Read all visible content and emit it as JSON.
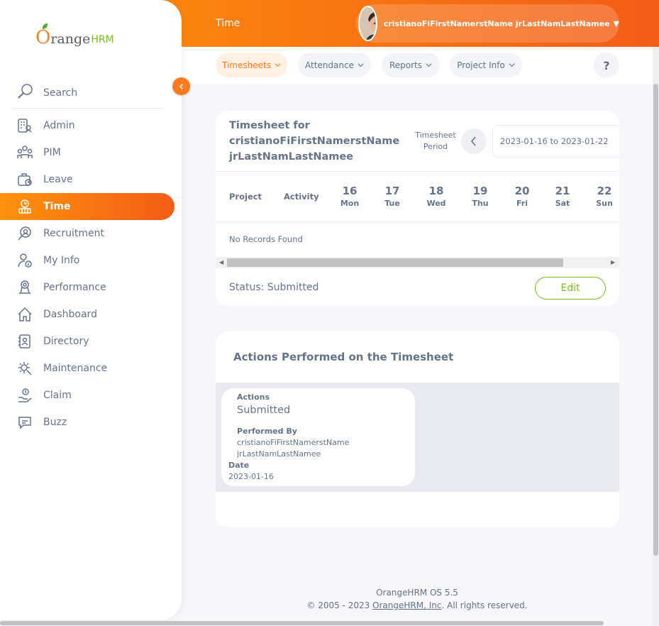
{
  "app": {
    "logo_o": "O",
    "logo_text": "range",
    "logo_suffix": "HRM"
  },
  "topbar": {
    "page_title": "Time",
    "user_name": "cristianoFiFirstNamerstName jrLastNamLastNamee"
  },
  "sidebar": {
    "search_label": "Search",
    "items": [
      {
        "label": "Admin",
        "icon": "admin-icon"
      },
      {
        "label": "PIM",
        "icon": "pim-icon"
      },
      {
        "label": "Leave",
        "icon": "leave-icon"
      },
      {
        "label": "Time",
        "icon": "time-icon",
        "active": true
      },
      {
        "label": "Recruitment",
        "icon": "recruitment-icon"
      },
      {
        "label": "My Info",
        "icon": "my-info-icon"
      },
      {
        "label": "Performance",
        "icon": "performance-icon"
      },
      {
        "label": "Dashboard",
        "icon": "dashboard-icon"
      },
      {
        "label": "Directory",
        "icon": "directory-icon"
      },
      {
        "label": "Maintenance",
        "icon": "maintenance-icon"
      },
      {
        "label": "Claim",
        "icon": "claim-icon"
      },
      {
        "label": "Buzz",
        "icon": "buzz-icon"
      }
    ]
  },
  "subnav": {
    "tabs": [
      {
        "label": "Timesheets",
        "active": true
      },
      {
        "label": "Attendance"
      },
      {
        "label": "Reports"
      },
      {
        "label": "Project Info"
      }
    ],
    "help_label": "?"
  },
  "timesheet": {
    "title_prefix": "Timesheet for",
    "employee_first": "cristianoFiFirstNamerstName",
    "employee_last": "jrLastNamLastNamee",
    "period_label_line1": "Timesheet",
    "period_label_line2": "Period",
    "period_value": "2023-01-16 to 2023-01-22",
    "columns": {
      "project": "Project",
      "activity": "Activity"
    },
    "days": [
      {
        "num": "16",
        "dow": "Mon"
      },
      {
        "num": "17",
        "dow": "Tue"
      },
      {
        "num": "18",
        "dow": "Wed"
      },
      {
        "num": "19",
        "dow": "Thu"
      },
      {
        "num": "20",
        "dow": "Fri"
      },
      {
        "num": "21",
        "dow": "Sat"
      },
      {
        "num": "22",
        "dow": "Sun"
      }
    ],
    "empty_text": "No Records Found",
    "status_text": "Status: Submitted",
    "edit_label": "Edit"
  },
  "actions": {
    "title": "Actions Performed on the Timesheet",
    "actions_label": "Actions",
    "action_value": "Submitted",
    "performed_by_label": "Performed By",
    "performed_by_line1": "cristianoFiFirstNamerstName",
    "performed_by_line2": "jrLastNamLastNamee",
    "date_label": "Date",
    "date_value": "2023-01-16"
  },
  "footer": {
    "version": "OrangeHRM OS 5.5",
    "copyright_prefix": "© 2005 - 2023 ",
    "company_link": "OrangeHRM, Inc",
    "copyright_suffix": ". All rights reserved."
  },
  "colors": {
    "accent": "#ff7b1d",
    "edit_green": "#76bc21",
    "text": "#64728c"
  }
}
